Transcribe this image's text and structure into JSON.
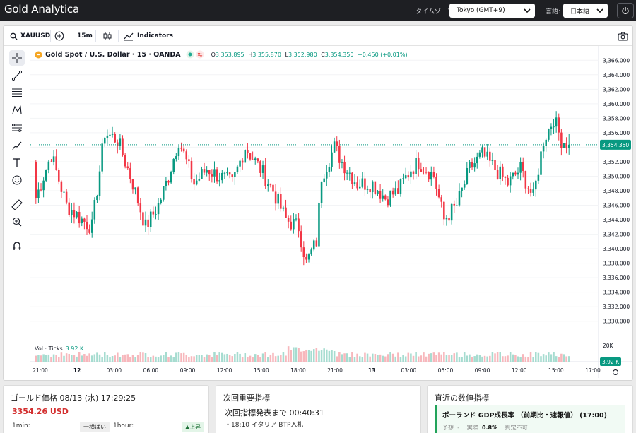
{
  "app": {
    "title": "Gold Analytica",
    "timezone_label": "タイムゾーン:",
    "timezone_value": "Tokyo (GMT+9)",
    "language_label": "言語:",
    "language_value": "日本語"
  },
  "toolbar": {
    "symbol": "XAUUSD",
    "interval": "15m",
    "indicators_label": "Indicators"
  },
  "legend": {
    "title": "Gold Spot / U.S. Dollar · 15 · OANDA",
    "o_label": "O",
    "o_value": "3,353.895",
    "h_label": "H",
    "h_value": "3,355.870",
    "l_label": "L",
    "l_value": "3,352.980",
    "c_label": "C",
    "c_value": "3,354.350",
    "change": "+0.450 (+0.01%)"
  },
  "volume": {
    "label": "Vol · Ticks",
    "value": "3.92 K"
  },
  "chart_data": {
    "type": "candlestick",
    "price_ticks": [
      "3,366.000",
      "3,364.000",
      "3,362.000",
      "3,360.000",
      "3,358.000",
      "3,356.000",
      "3,354.000",
      "3,352.000",
      "3,350.000",
      "3,348.000",
      "3,346.000",
      "3,344.000",
      "3,342.000",
      "3,340.000",
      "3,338.000",
      "3,336.000",
      "3,334.000",
      "3,332.000",
      "3,330.000"
    ],
    "ylim": [
      3329,
      3367
    ],
    "current_price_label": "3,354.350",
    "current_price": 3354.35,
    "volume_axis_label": "20K",
    "volume_value_label": "3.92 K",
    "volume_max": 20000,
    "time_ticks": [
      "21:00",
      "12",
      "03:00",
      "06:00",
      "09:00",
      "12:00",
      "15:00",
      "18:00",
      "21:00",
      "13",
      "03:00",
      "06:00",
      "09:00",
      "12:00",
      "15:00",
      "17:00"
    ],
    "up_color": "#089981",
    "down_color": "#f23645",
    "candles": []
  },
  "panels": {
    "gold_price": {
      "title": "ゴールド価格 08/13 (水) 17:29:25",
      "price": "3354.26 USD",
      "tf1_label": "1min:",
      "tf1_badge": "一横ばい",
      "tf2_label": "1hour:",
      "tf2_badge": "▲上昇"
    },
    "next_indicator": {
      "title": "次回重要指標",
      "countdown": "次回指標発表まで 00:40:31",
      "item": "・18:10 イタリア BTP入札"
    },
    "recent_indicator": {
      "title": "直近の数値指標",
      "item_title": "ポーランド GDP成長率 （前期比・速報値） (17:00)",
      "forecast_label": "予想:",
      "forecast_value": "-",
      "actual_label": "実際:",
      "actual_value": "0.8%",
      "judgement": "判定不可"
    }
  }
}
